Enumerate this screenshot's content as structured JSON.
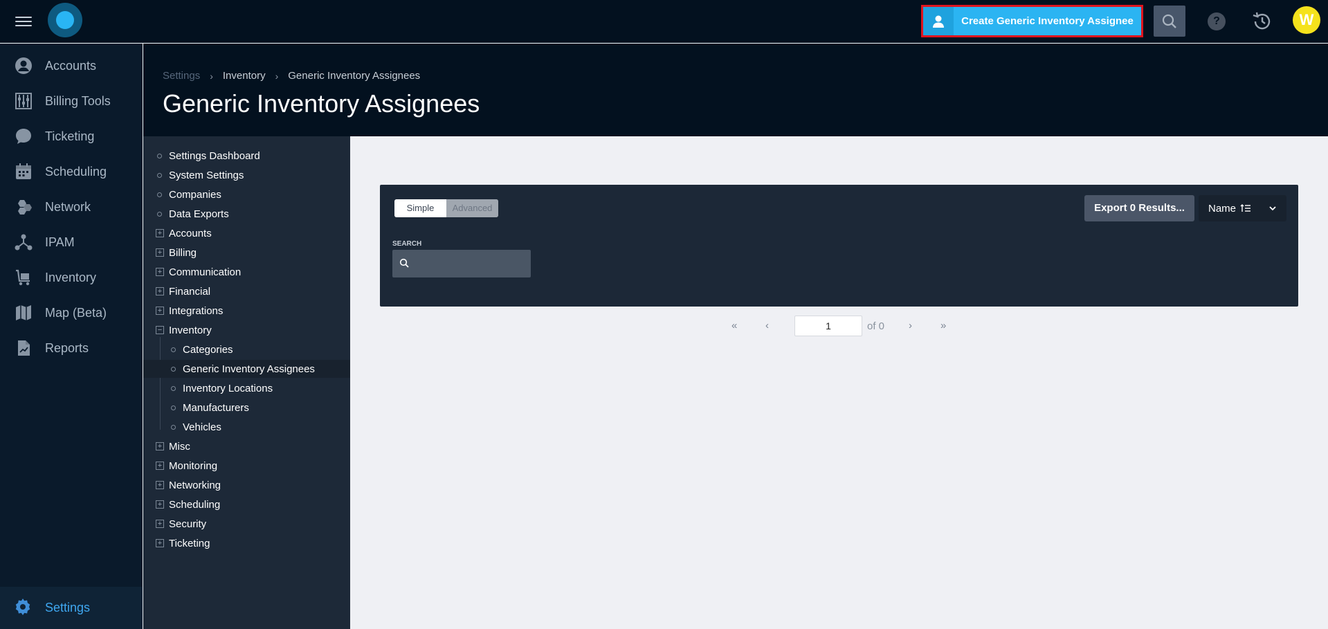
{
  "topbar": {
    "create_button_label": "Create Generic Inventory Assignee",
    "avatar_initial": "W",
    "help_label": "?"
  },
  "nav": {
    "items": [
      {
        "label": "Accounts",
        "icon": "person-icon"
      },
      {
        "label": "Billing Tools",
        "icon": "abacus-icon"
      },
      {
        "label": "Ticketing",
        "icon": "chat-bubble-icon"
      },
      {
        "label": "Scheduling",
        "icon": "calendar-icon"
      },
      {
        "label": "Network",
        "icon": "hexagons-icon"
      },
      {
        "label": "IPAM",
        "icon": "network-nodes-icon"
      },
      {
        "label": "Inventory",
        "icon": "cart-icon"
      },
      {
        "label": "Map (Beta)",
        "icon": "map-icon"
      },
      {
        "label": "Reports",
        "icon": "report-icon"
      }
    ],
    "settings_label": "Settings"
  },
  "breadcrumb": {
    "root": "Settings",
    "middle": "Inventory",
    "current": "Generic Inventory Assignees",
    "separator": "›"
  },
  "page_title": "Generic Inventory Assignees",
  "tree": {
    "items": [
      {
        "label": "Settings Dashboard",
        "kind": "leaf"
      },
      {
        "label": "System Settings",
        "kind": "leaf"
      },
      {
        "label": "Companies",
        "kind": "leaf"
      },
      {
        "label": "Data Exports",
        "kind": "leaf"
      },
      {
        "label": "Accounts",
        "kind": "collapsed"
      },
      {
        "label": "Billing",
        "kind": "collapsed"
      },
      {
        "label": "Communication",
        "kind": "collapsed"
      },
      {
        "label": "Financial",
        "kind": "collapsed"
      },
      {
        "label": "Integrations",
        "kind": "collapsed"
      },
      {
        "label": "Inventory",
        "kind": "expanded"
      },
      {
        "label": "Categories",
        "kind": "child"
      },
      {
        "label": "Generic Inventory Assignees",
        "kind": "child-active"
      },
      {
        "label": "Inventory Locations",
        "kind": "child"
      },
      {
        "label": "Manufacturers",
        "kind": "child"
      },
      {
        "label": "Vehicles",
        "kind": "child"
      },
      {
        "label": "Misc",
        "kind": "collapsed"
      },
      {
        "label": "Monitoring",
        "kind": "collapsed"
      },
      {
        "label": "Networking",
        "kind": "collapsed"
      },
      {
        "label": "Scheduling",
        "kind": "collapsed"
      },
      {
        "label": "Security",
        "kind": "collapsed"
      },
      {
        "label": "Ticketing",
        "kind": "collapsed"
      }
    ],
    "expand_symbol": "+",
    "collapse_symbol": "−"
  },
  "filter": {
    "simple_label": "Simple",
    "advanced_label": "Advanced",
    "search_label": "SEARCH",
    "search_value": "",
    "export_label": "Export 0 Results...",
    "sort_label": "Name"
  },
  "pager": {
    "first": "«",
    "prev": "‹",
    "page_value": "1",
    "of_label": "of 0",
    "next": "›",
    "last": "»"
  },
  "colors": {
    "accent": "#2bb4f2",
    "highlight_border": "#e0141e",
    "settings_active": "#3fa7f0",
    "avatar": "#f5e21c"
  }
}
